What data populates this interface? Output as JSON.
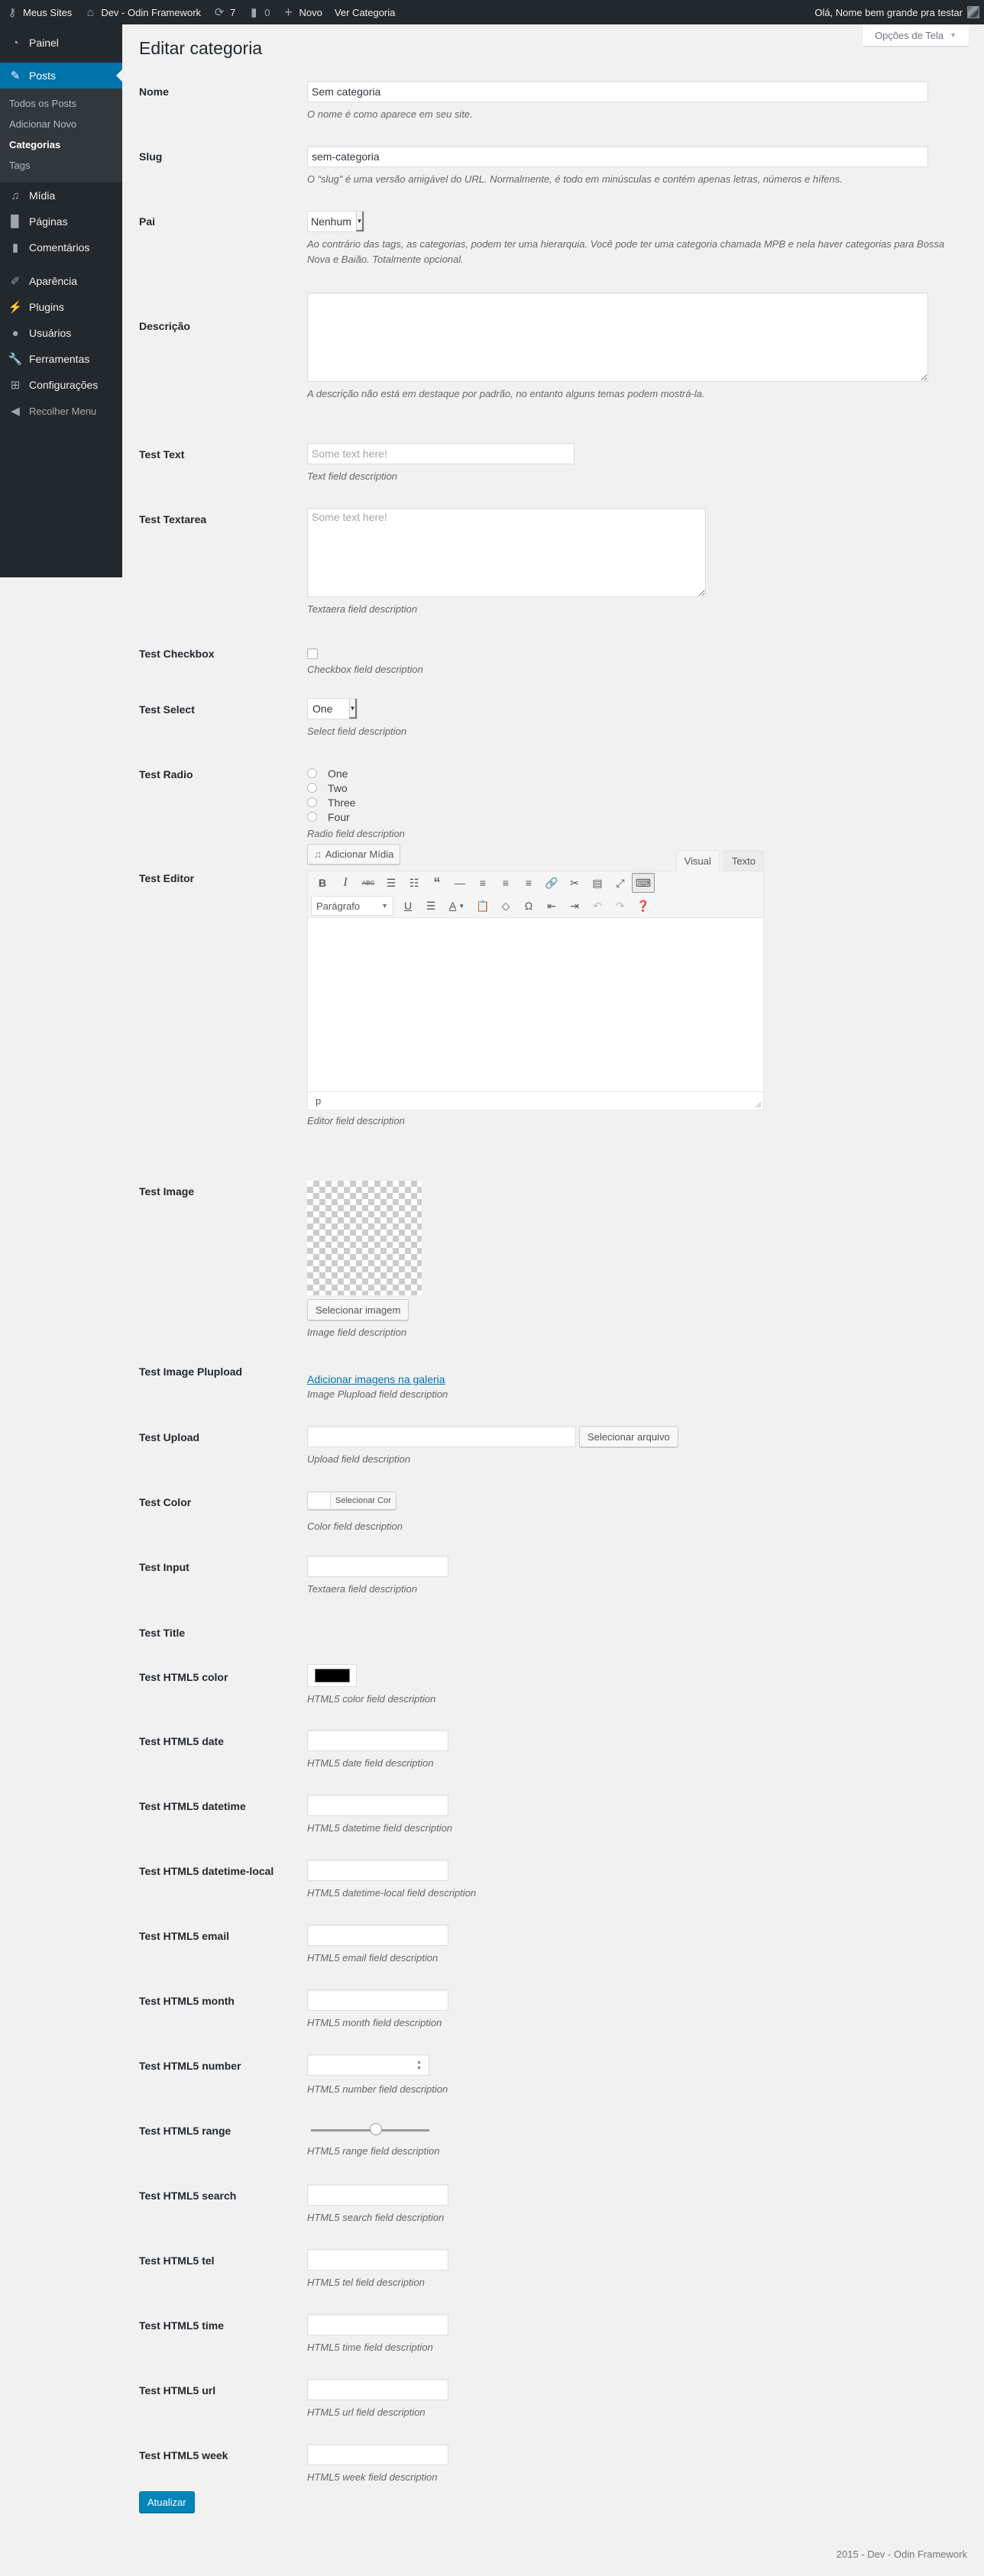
{
  "adminbar": {
    "my_sites": "Meus Sites",
    "site_name": "Dev - Odin Framework",
    "updates_count": "7",
    "comments_count": "0",
    "new_label": "Novo",
    "view_label": "Ver Categoria",
    "greeting": "Olá, Nome bem grande pra testar"
  },
  "sidebar": {
    "items": [
      {
        "label": "Painel",
        "icon": "dashboard-icon"
      },
      {
        "label": "Posts",
        "icon": "pin-icon",
        "current": true
      },
      {
        "label": "Mídia",
        "icon": "media-icon"
      },
      {
        "label": "Páginas",
        "icon": "pages-icon"
      },
      {
        "label": "Comentários",
        "icon": "comments-icon"
      },
      {
        "label": "Aparência",
        "icon": "appearance-icon"
      },
      {
        "label": "Plugins",
        "icon": "plugins-icon"
      },
      {
        "label": "Usuários",
        "icon": "users-icon"
      },
      {
        "label": "Ferramentas",
        "icon": "tools-icon"
      },
      {
        "label": "Configurações",
        "icon": "settings-icon"
      }
    ],
    "submenu": [
      "Todos os Posts",
      "Adicionar Novo",
      "Categorias",
      "Tags"
    ],
    "submenu_active": "Categorias",
    "collapse": "Recolher Menu"
  },
  "screen_options": "Opções de Tela",
  "page_title": "Editar categoria",
  "fields": {
    "name": {
      "label": "Nome",
      "value": "Sem categoria",
      "desc": "O nome é como aparece em seu site."
    },
    "slug": {
      "label": "Slug",
      "value": "sem-categoria",
      "desc": "O “slug” é uma versão amigável do URL. Normalmente, é todo em minúsculas e contém apenas letras, números e hífens."
    },
    "parent": {
      "label": "Pai",
      "value": "Nenhum",
      "desc": "Ao contrário das tags, as categorias, podem ter uma hierarquia. Você pode ter uma categoria chamada MPB e nela haver categorias para Bossa Nova e Baião. Totalmente opcional."
    },
    "description": {
      "label": "Descrição",
      "value": "",
      "desc": "A descrição não está em destaque por padrão, no entanto alguns temas podem mostrá-la."
    },
    "test_text": {
      "label": "Test Text",
      "placeholder": "Some text here!",
      "desc": "Text field description"
    },
    "test_textarea": {
      "label": "Test Textarea",
      "placeholder": "Some text here!",
      "desc": "Textaera field description"
    },
    "test_checkbox": {
      "label": "Test Checkbox",
      "checked": false,
      "desc": "Checkbox field description"
    },
    "test_select": {
      "label": "Test Select",
      "value": "One",
      "desc": "Select field description"
    },
    "test_radio": {
      "label": "Test Radio",
      "options": [
        "One",
        "Two",
        "Three",
        "Four"
      ],
      "desc": "Radio field description"
    },
    "test_editor": {
      "label": "Test Editor",
      "add_media": "Adicionar Mídia",
      "tab_visual": "Visual",
      "tab_text": "Texto",
      "format": "Parágrafo",
      "status_path": "p",
      "desc": "Editor field description"
    },
    "test_image": {
      "label": "Test Image",
      "button": "Selecionar imagem",
      "desc": "Image field description"
    },
    "test_plupload": {
      "label": "Test Image Plupload",
      "link": "Adicionar imagens na galeria",
      "desc": "Image Plupload field description"
    },
    "test_upload": {
      "label": "Test Upload",
      "value": "",
      "button": "Selecionar arquivo",
      "desc": "Upload field description"
    },
    "test_color": {
      "label": "Test Color",
      "button": "Selecionar Cor",
      "desc": "Color field description"
    },
    "test_input": {
      "label": "Test Input",
      "value": "",
      "desc": "Textaera field description"
    },
    "test_title": {
      "label": "Test Title"
    },
    "html5_color": {
      "label": "Test HTML5 color",
      "value": "#000000",
      "desc": "HTML5 color field description"
    },
    "html5_date": {
      "label": "Test HTML5 date",
      "desc": "HTML5 date field description"
    },
    "html5_datetime": {
      "label": "Test HTML5 datetime",
      "desc": "HTML5 datetime field description"
    },
    "html5_datetime_local": {
      "label": "Test HTML5 datetime-local",
      "desc": "HTML5 datetime-local field description"
    },
    "html5_email": {
      "label": "Test HTML5 email",
      "desc": "HTML5 email field description"
    },
    "html5_month": {
      "label": "Test HTML5 month",
      "desc": "HTML5 month field description"
    },
    "html5_number": {
      "label": "Test HTML5 number",
      "desc": "HTML5 number field description"
    },
    "html5_range": {
      "label": "Test HTML5 range",
      "value_percent": 50,
      "desc": "HTML5 range field description"
    },
    "html5_search": {
      "label": "Test HTML5 search",
      "desc": "HTML5 search field description"
    },
    "html5_tel": {
      "label": "Test HTML5 tel",
      "desc": "HTML5 tel field description"
    },
    "html5_time": {
      "label": "Test HTML5 time",
      "desc": "HTML5 time field description"
    },
    "html5_url": {
      "label": "Test HTML5 url",
      "desc": "HTML5 url field description"
    },
    "html5_week": {
      "label": "Test HTML5 week",
      "desc": "HTML5 week field description"
    }
  },
  "submit_label": "Atualizar",
  "footer": "2015 - Dev - Odin Framework",
  "colors": {
    "accent": "#0073aa",
    "primary_button": "#0085ba",
    "adminbar": "#23282d",
    "submenu": "#32373c",
    "background": "#f1f1f1"
  }
}
